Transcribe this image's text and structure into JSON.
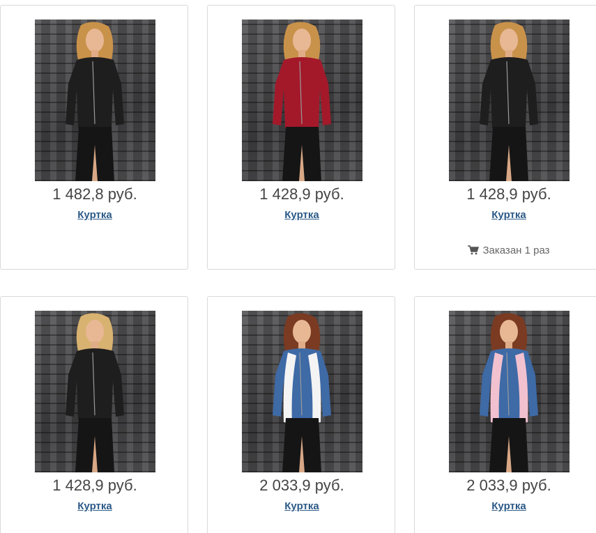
{
  "products": [
    {
      "price": "1 482,8 руб.",
      "title": "Куртка",
      "jacket_color": "#1e1e1e",
      "skirt_color": "#151515",
      "hair_color": "#c9924a"
    },
    {
      "price": "1 428,9 руб.",
      "title": "Куртка",
      "jacket_color": "#a3192a",
      "skirt_color": "#151515",
      "hair_color": "#c9924a"
    },
    {
      "price": "1 428,9 руб.",
      "title": "Куртка",
      "jacket_color": "#1e1e1e",
      "skirt_color": "#151515",
      "hair_color": "#c9924a",
      "ordered_text": "Заказан 1 раз",
      "ordered_icon": "cart-icon"
    },
    {
      "price": "1 428,9 руб.",
      "title": "Куртка",
      "jacket_color": "#1e1e1e",
      "skirt_color": "#151515",
      "hair_color": "#d8b270"
    },
    {
      "price": "2 033,9 руб.",
      "title": "Куртка",
      "jacket_color": "#3e6aa6",
      "skirt_color": "#151515",
      "hair_color": "#7a3b22",
      "fur_color": "#f4f4f4"
    },
    {
      "price": "2 033,9 руб.",
      "title": "Куртка",
      "jacket_color": "#3e6aa6",
      "skirt_color": "#151515",
      "hair_color": "#7a3b22",
      "fur_color": "#f2c1cf"
    }
  ]
}
